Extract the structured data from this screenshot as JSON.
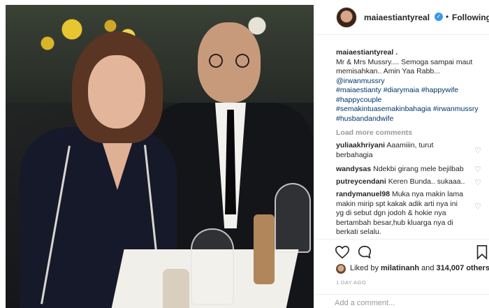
{
  "post": {
    "username": "maiaestiantyreal",
    "follow_label": "Following",
    "separator": "•",
    "verified_icon": "verified-badge-icon"
  },
  "caption": {
    "username": "maiaestiantyreal .",
    "lines": [
      "Mr & Mrs Mussry.... Semoga sampai maut",
      "memisahkan.. Amin Yaa Rabb..."
    ],
    "tag_lines": [
      "@irwanmussry",
      "#maiaestianty #diarymaia #happywife",
      "#happycouple",
      "#semakintuasemakinbahagia #irwanmussry",
      "#husbandandwife"
    ]
  },
  "load_more": "Load more comments",
  "comments": [
    {
      "user": "yuliaakhriyani",
      "lines": [
        "Aaamiiin, turut",
        "berbahagia"
      ]
    },
    {
      "user": "wandysas",
      "lines": [
        "Ndekbi girang mele bejilbab"
      ]
    },
    {
      "user": "putreycendani",
      "lines": [
        "Keren Bunda.. sukaaa.."
      ]
    },
    {
      "user": "randymanuel98",
      "lines": [
        "Muka nya makin lama",
        "makin mirip spt kakak adik arti nya ini",
        "yg di sebut dgn jodoh & hokie nya",
        "bertambah besar,hub kluarga nya di",
        "berkati selalu."
      ]
    }
  ],
  "actions": {
    "like_icon": "heart-icon",
    "comment_icon": "comment-icon",
    "save_icon": "bookmark-icon"
  },
  "likes": {
    "prefix": "Liked by ",
    "user": "milatinanh",
    "middle": " and ",
    "count": "314,007 others"
  },
  "timestamp": "1 DAY AGO",
  "add_comment": {
    "placeholder": "Add a comment..."
  },
  "colors": {
    "link": "#003569",
    "muted": "#999999",
    "verified": "#3897f0",
    "text": "#262626"
  }
}
